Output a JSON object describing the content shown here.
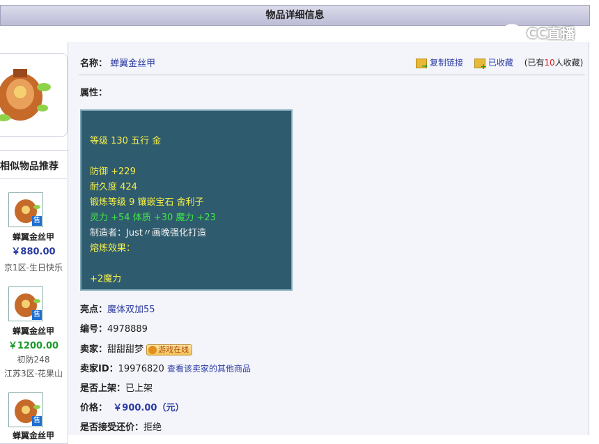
{
  "header": {
    "title": "物品详细信息"
  },
  "watermark": {
    "text": "CC直播"
  },
  "recommend": {
    "title": "相似物品推荐",
    "items": [
      {
        "name": "蝉翼金丝甲",
        "price": "￥880.00",
        "price_color": "#2a3aa0",
        "sub": "京1区-生日快乐",
        "sub2": ""
      },
      {
        "name": "蝉翼金丝甲",
        "price": "￥1200.00",
        "price_color": "#1a9a2a",
        "sub": "初防248",
        "sub2": "江苏3区-花果山"
      },
      {
        "name": "蝉翼金丝甲",
        "price": "",
        "price_color": "#2a3aa0",
        "sub": "",
        "sub2": ""
      }
    ],
    "sell_badge": "售"
  },
  "item": {
    "name_label": "名称：",
    "name": "蝉翼金丝甲",
    "actions": {
      "copy_link": "复制链接",
      "favorited": "已收藏",
      "fav_count_prefix": "(已有",
      "fav_count": "10",
      "fav_count_suffix": "人收藏)"
    },
    "attr_label": "属性：",
    "attrs": {
      "level_line": "等级 130 五行 金",
      "defense": "防御 +229",
      "durability": "耐久度 424",
      "forge": "锻炼等级 9 镶嵌宝石 舍利子",
      "stats": "灵力 +54 体质 +30 魔力 +23",
      "maker": "制造者：Just〃画晚强化打造",
      "melt_label": "熔炼效果：",
      "melt_value": "+2魔力"
    },
    "highlight_label": "亮点：",
    "highlight": "魔体双加55",
    "id_label": "编号：",
    "id": "4978889",
    "seller_label": "卖家：",
    "seller": "甜甜甜梦",
    "online_badge": "游戏在线",
    "seller_id_label": "卖家ID：",
    "seller_id": "19976820",
    "seller_other_link": "查看该卖家的其他商品",
    "listed_label": "是否上架：",
    "listed": "已上架",
    "price_label": "价格：",
    "price": "￥900.00（元）",
    "counter_label": "是否接受还价：",
    "counter": "拒绝"
  }
}
